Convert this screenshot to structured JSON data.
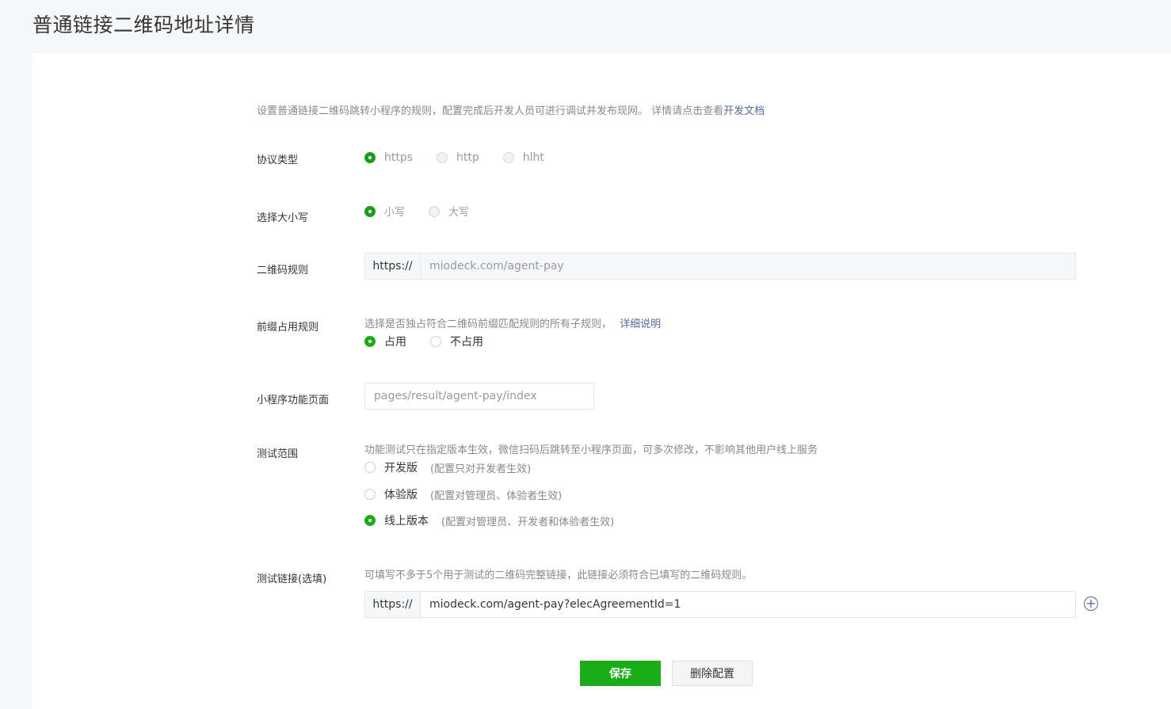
{
  "page_title": "普通链接二维码地址详情",
  "intro": {
    "text": "设置普通链接二维码跳转小程序的规则，配置完成后开发人员可进行调试并发布现网。 详情请点击查看",
    "link": "开发文档"
  },
  "protocol": {
    "label": "协议类型",
    "options": [
      "https",
      "http",
      "hlht"
    ],
    "selected": "https"
  },
  "case": {
    "label": "选择大小写",
    "options": [
      "小写",
      "大写"
    ],
    "selected": "小写"
  },
  "qr_rule": {
    "label": "二维码规则",
    "prefix": "https://",
    "value": "miodeck.com/agent-pay"
  },
  "prefix_occupy": {
    "label": "前缀占用规则",
    "hint": "选择是否独占符合二维码前缀匹配规则的所有子规则，",
    "hint_link": "详细说明",
    "options": [
      "占用",
      "不占用"
    ],
    "selected": "占用"
  },
  "mini_page": {
    "label": "小程序功能页面",
    "value": "pages/result/agent-pay/index"
  },
  "test_scope": {
    "label": "测试范围",
    "hint": "功能测试只在指定版本生效，微信扫码后跳转至小程序页面，可多次修改，不影响其他用户线上服务",
    "options": [
      {
        "name": "开发版",
        "desc": "(配置只对开发者生效)"
      },
      {
        "name": "体验版",
        "desc": "(配置对管理员、体验者生效)"
      },
      {
        "name": "线上版本",
        "desc": "(配置对管理员、开发者和体验者生效)"
      }
    ],
    "selected": "线上版本"
  },
  "test_link": {
    "label": "测试链接(选填)",
    "hint": "可填写不多于5个用于测试的二维码完整链接，此链接必须符合已填写的二维码规则。",
    "prefix": "https://",
    "value": "miodeck.com/agent-pay?elecAgreementId=1",
    "add_icon": "plus-circle-icon"
  },
  "actions": {
    "save": "保存",
    "delete": "删除配置"
  }
}
